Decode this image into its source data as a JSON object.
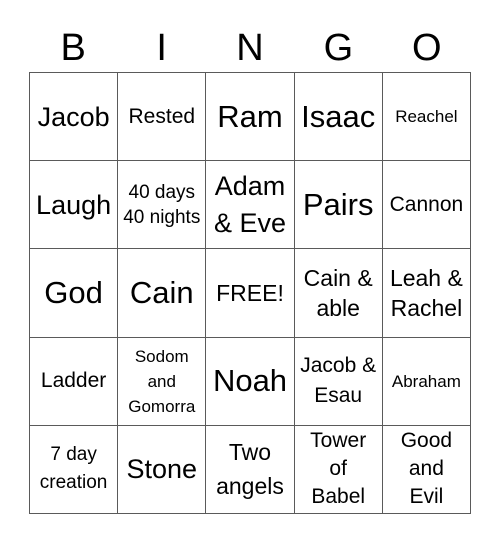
{
  "header": {
    "letters": [
      "B",
      "I",
      "N",
      "G",
      "O"
    ]
  },
  "grid": {
    "rows": [
      [
        "Jacob",
        "Rested",
        "Ram",
        "Isaac",
        "Reachel"
      ],
      [
        "Laugh",
        "40 days 40 nights",
        "Adam & Eve",
        "Pairs",
        "Cannon"
      ],
      [
        "God",
        "Cain",
        "FREE!",
        "Cain & able",
        "Leah & Rachel"
      ],
      [
        "Ladder",
        "Sodom and Gomorra",
        "Noah",
        "Jacob & Esau",
        "Abraham"
      ],
      [
        "7 day creation",
        "Stone",
        "Two angels",
        "Tower of Babel",
        "Good and Evil"
      ]
    ]
  }
}
